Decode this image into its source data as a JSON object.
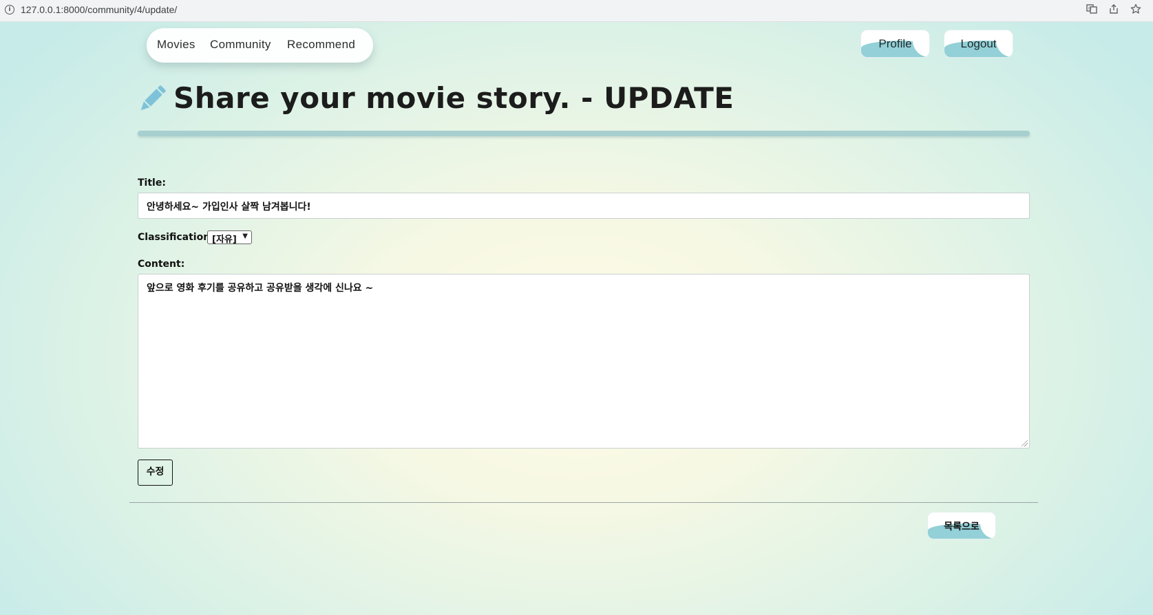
{
  "browser": {
    "url": "127.0.0.1:8000/community/4/update/"
  },
  "nav": {
    "links": [
      "Movies",
      "Community",
      "Recommend"
    ],
    "profile_label": "Profile",
    "logout_label": "Logout"
  },
  "header": {
    "title": "Share your movie story. - UPDATE"
  },
  "form": {
    "title_label": "Title:",
    "title_value": "안녕하세요~ 가입인사 살짝 남겨봅니다!",
    "classification_label": "Classification:",
    "classification_value": "[자유]",
    "content_label": "Content:",
    "content_value": "앞으로 영화 후기를 공유하고 공유받을 생각에 신나요 ~",
    "submit_label": "수정"
  },
  "footer": {
    "back_label": "목록으로"
  },
  "colors": {
    "accent_wave": "#93d0d7",
    "pencil": "#7ec2d9",
    "title_rule": "#a8cfcf"
  }
}
